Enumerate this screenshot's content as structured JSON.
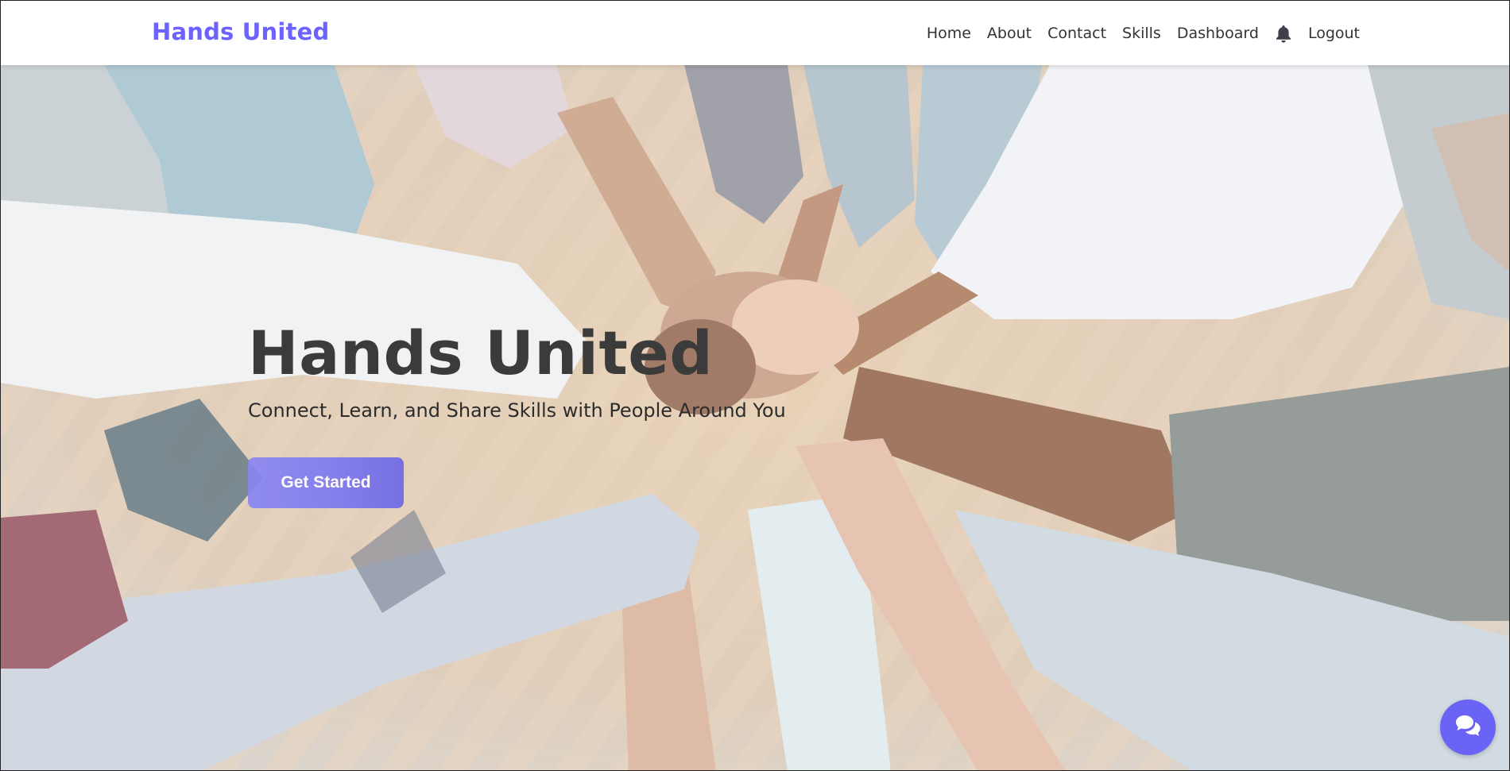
{
  "header": {
    "brand": "Hands United",
    "nav": {
      "home": "Home",
      "about": "About",
      "contact": "Contact",
      "skills": "Skills",
      "dashboard": "Dashboard",
      "logout": "Logout"
    },
    "icons": {
      "notifications": "bell-icon"
    }
  },
  "hero": {
    "title": "Hands United",
    "subtitle": "Connect, Learn, and Share Skills with People Around You",
    "cta": "Get Started",
    "background": "people-joining-hands-photo"
  },
  "widgets": {
    "chat": "chat-icon"
  },
  "colors": {
    "brand": "#6c63ff",
    "cta": "#7f7bf0",
    "chat": "#6a63f6"
  }
}
